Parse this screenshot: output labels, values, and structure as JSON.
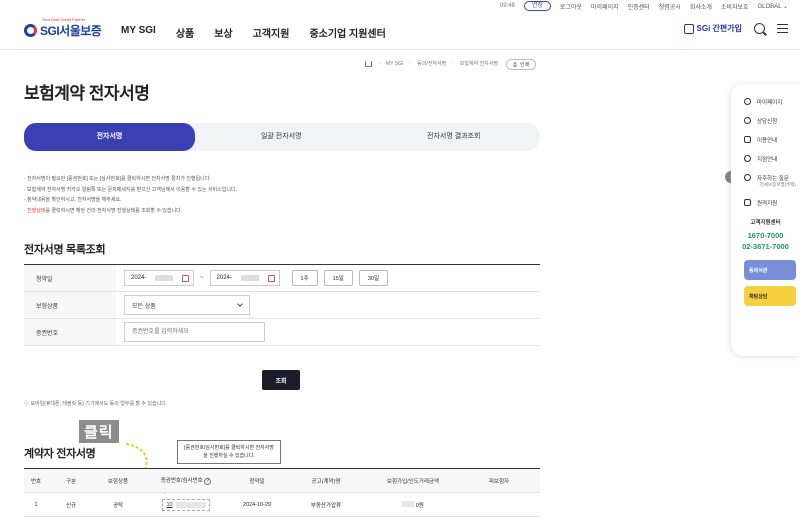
{
  "util": {
    "timer": "09:48",
    "extend": "연장",
    "links": [
      "로그아웃",
      "마이페이지",
      "인증센터",
      "청렴공시",
      "회사소개",
      "소비자보호",
      "GLOBAL ⌄"
    ]
  },
  "header": {
    "logo_tag": "Your Best Credit Partner",
    "logo": "SGI서울보증",
    "menu": [
      "MY SGI",
      "상품",
      "보상",
      "고객지원",
      "중소기업 지원센터"
    ],
    "simple_join": "SGi 간편가입"
  },
  "breadcrumb": [
    "MY SGI",
    "동의/전자서명",
    "보험계약 전자서명"
  ],
  "print": "인쇄",
  "page_title": "보험계약 전자서명",
  "tabs": [
    "전자서명",
    "일괄 전자서명",
    "전자서명 결과조회"
  ],
  "notes": [
    "· 전자서명이 필요한 [증권번호] 또는 [심사번호]를 클릭하시면 전자서명 절차가 진행됩니다.",
    "· 보험계약 전자서명 카카오 알림톡 또는 문자메세지를 받으신 고객님께서 이용할 수 있는 서비스입니다.",
    "· 청약내용을 확인하시고, 전자서명을 해주세요.",
    "진행상태",
    "를 클릭하시면 해당 건의 전자서명 진행상태를 조회할 수 있습니다."
  ],
  "search": {
    "title": "전자서명 목록조회",
    "rows": {
      "date_label": "청약일",
      "date_from": "2024-",
      "date_to": "2024-",
      "periods": [
        "1주",
        "15일",
        "30일"
      ],
      "product_label": "보험상품",
      "product_value": "모든 상품",
      "policy_label": "증권번호",
      "policy_placeholder": "증권번호를 입력하세요"
    },
    "button": "조회"
  },
  "info": "ⓘ 모바일(휴대폰, 태블릿 등) 기기에서도 동의 업무를 할 수 있습니다.",
  "contracts": {
    "title": "계약자 전자서명",
    "headers": [
      "번호",
      "구분",
      "보험상품",
      "증권번호/심사번호",
      "청약일",
      "공고(계약)명",
      "보험가입/인도거래금액",
      "피보험자"
    ],
    "rows": [
      {
        "no": "1",
        "type": "신규",
        "product": "공탁",
        "policy": "10",
        "date": "2024-10-29",
        "name": "부동산가압류",
        "amount": "0원",
        "insured": ""
      }
    ]
  },
  "tooltip": "[증권번호/심사번호]를 클릭하시면 전자서명을 진행하실 수 있습니다.",
  "click_label": "클릭",
  "quick": {
    "items": [
      "마이페이지",
      "상담신청",
      "이용안내",
      "지점안내",
      "자주하는 질문",
      "원격지원"
    ],
    "faq_sub": "· 전세보증보험(주택)",
    "center_title": "고객지원센터",
    "phone1": "1670-7000",
    "phone2": "02-3671-7000",
    "banner1": "동의서관",
    "banner2": "채팅상담",
    "toggle": "›"
  }
}
